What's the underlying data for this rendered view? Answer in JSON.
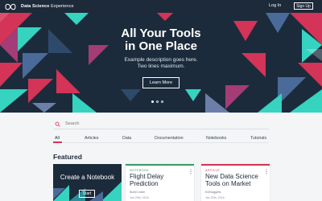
{
  "topbar": {
    "brand_strong": "Data Science",
    "brand_rest": " Experience",
    "login": "Log In",
    "signup": "Sign Up",
    "brand_icon": "infinity-logo-icon"
  },
  "hero": {
    "title_line1": "All Your Tools",
    "title_line2": "in One Place",
    "desc_line1": "Example description goes here.",
    "desc_line2": "Two lines maximum.",
    "cta": "Learn More",
    "slides": 3,
    "active_slide": 1
  },
  "search": {
    "placeholder": "Search",
    "icon": "search-icon"
  },
  "tabs": [
    {
      "label": "All"
    },
    {
      "label": "Articles"
    },
    {
      "label": "Data"
    },
    {
      "label": "Documentation"
    },
    {
      "label": "Notebooks"
    },
    {
      "label": "Tutorials"
    }
  ],
  "featured": {
    "heading": "Featured",
    "notebook_card": {
      "title": "Create a Notebook",
      "cta": "Start"
    },
    "cards": [
      {
        "kind": "NOTEBOOK",
        "title_line1": "Flight Delay",
        "title_line2": "Prediction",
        "author": "Bobit Leam",
        "date": "Jan 29th, 2016"
      },
      {
        "kind": "ARTICLE",
        "title_line1": "New Data Science",
        "title_line2": "Tools on Market",
        "author": "KDNuggets",
        "date": "Jan 29th, 2016"
      }
    ]
  },
  "colors": {
    "navy": "#1c2b3b",
    "magenta": "#d33457",
    "teal": "#35d3c0",
    "green": "#3b9b6a"
  }
}
